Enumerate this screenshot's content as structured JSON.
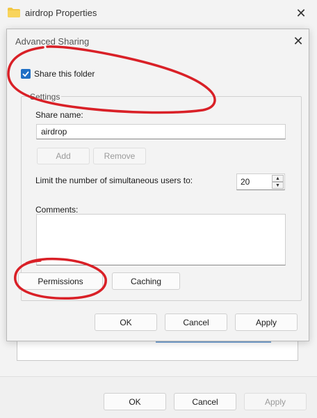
{
  "outer_window": {
    "title": "airdrop Properties",
    "footer": {
      "ok_label": "OK",
      "cancel_label": "Cancel",
      "apply_label": "Apply"
    }
  },
  "dialog": {
    "title": "Advanced Sharing",
    "share_checkbox_label": "Share this folder",
    "share_checked": true,
    "settings_legend": "Settings",
    "share_name_label": "Share name:",
    "share_name_value": "airdrop",
    "add_label": "Add",
    "remove_label": "Remove",
    "limit_label": "Limit the number of simultaneous users to:",
    "limit_value": "20",
    "comments_label": "Comments:",
    "comments_value": "",
    "permissions_label": "Permissions",
    "caching_label": "Caching",
    "ok_label": "OK",
    "cancel_label": "Cancel",
    "apply_label": "Apply"
  },
  "colors": {
    "accent": "#1f6fc5",
    "annotation": "#d92027"
  },
  "icons": {
    "folder": "folder-icon",
    "close": "close-icon",
    "checkmark": "checkmark-icon",
    "spin_up": "chevron-up-icon",
    "spin_down": "chevron-down-icon"
  }
}
